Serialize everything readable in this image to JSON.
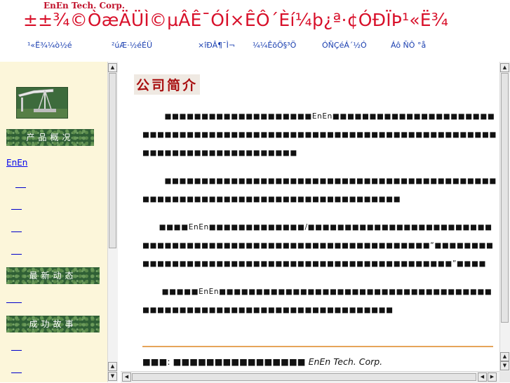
{
  "header": {
    "corp_name": "EnEn Tech. Corp.",
    "title": "±±¾©ÒæÄÜÌ©µÂÊ¯ÓÍ×ÊÔ´Èí¼þ¿ª·¢ÓÐÏÞ¹«Ë¾",
    "nav": [
      "¹«Ë¾¼ò½é",
      "²úÆ·½éÉÜ",
      "×îÐÂ¶¯Ì¬",
      "¼¼ÊõÖ§³Ö",
      "ÓÑÇéÁ´½Ó",
      "Áô ÑÔ °å"
    ]
  },
  "sidebar": {
    "section1": "产品概况",
    "product_link": "EnEn",
    "section2": "最新动态",
    "section3": "成功故事"
  },
  "main": {
    "heading": "公司简介",
    "paragraphs": [
      "        ■■■■■■■■■■■■■■■■■■■■EnEn■■■■■■■■■■■■■■■■■■■■■■■■■■■■■■■■■■■■■■■■■■■■■■■■■■■■■■■■■■■■■■■■■■■■■■■■■■■■■■■■■■■■■■■■■■■",
      "        ■■■■■■■■■■■■■■■■■■■■■■■■■■■■■■■■■■■■■■■■■■■■■■■■■■■■■■■■■■■■■■■■■■■■■■■■■■■■■■■■",
      "      ■■■■EnEn■■■■■■■■■■■■■/■■■■■■■■■■■■■■■■■■■■■■■■■■■■■■■■■■■■■■■■■■■■■■■■■■■■■■■■■■■■■■■■“■■■■■■■■■■■■■■■■■■■■■■■■■■■■■■■■■■■■■■■■■■■■■■■■■■”■■■■",
      "       ■■■■■EnEn■■■■■■■■■■■■■■■■■■■■■■■■■■■■■■■■■■■■■■■■■■■■■■■■■■■■■■■■■■■■■■■■■■■■■■■"
    ],
    "footer_label": "■■■:",
    "footer_text": "■■■■■■■■■■■■■■■■",
    "footer_corp": "EnEn Tech. Corp."
  },
  "colors": {
    "title": "#d8102a",
    "nav": "#1a3fb0",
    "sidebar_bg": "#fcf6da",
    "section_bg": "#2f5f35",
    "heading": "#a80f10",
    "rule": "#e6a55a"
  },
  "icons": {
    "up": "▲",
    "down": "▼",
    "left": "◀",
    "right": "▶"
  }
}
